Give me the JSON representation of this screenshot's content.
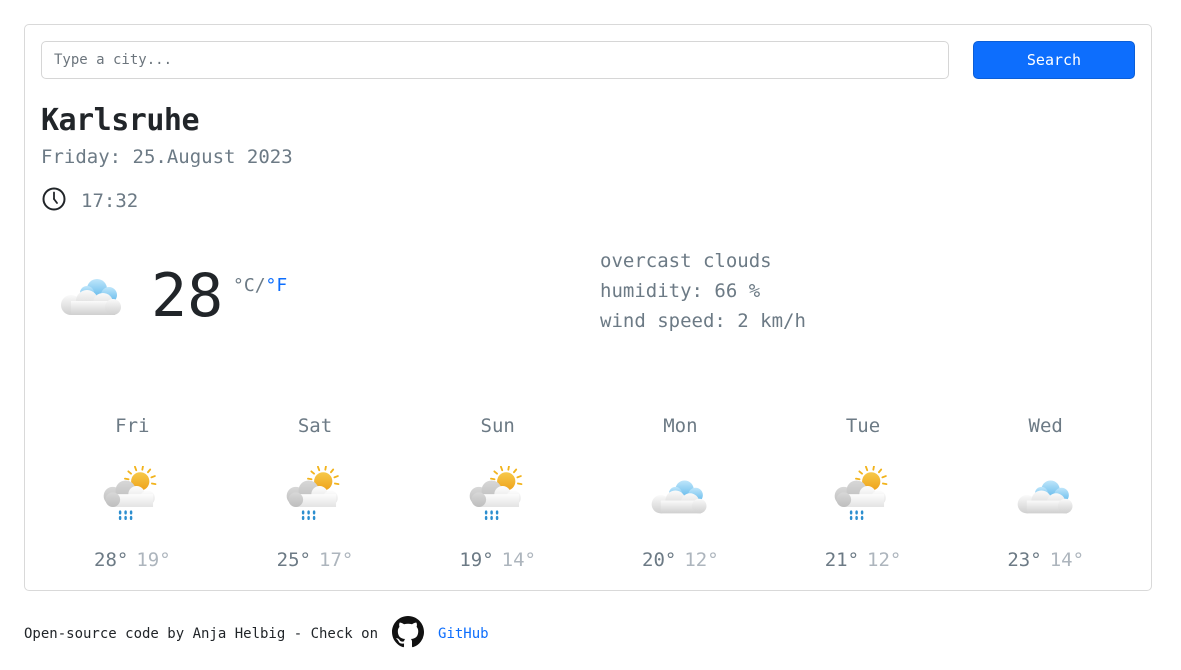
{
  "search": {
    "placeholder": "Type a city...",
    "button_label": "Search"
  },
  "current": {
    "city": "Karlsruhe",
    "date": "Friday: 25.August 2023",
    "time": "17:32",
    "temperature": "28",
    "unit_c": "°C",
    "unit_sep": "/",
    "unit_f": "°F",
    "icon": "overcast-clouds-icon",
    "description": "overcast clouds",
    "humidity": "humidity: 66 %",
    "wind": "wind speed: 2 km/h"
  },
  "forecast": [
    {
      "day": "Fri",
      "max": "28°",
      "min": "19°",
      "icon": "rain-sun-icon"
    },
    {
      "day": "Sat",
      "max": "25°",
      "min": "17°",
      "icon": "rain-sun-icon"
    },
    {
      "day": "Sun",
      "max": "19°",
      "min": "14°",
      "icon": "rain-sun-icon"
    },
    {
      "day": "Mon",
      "max": "20°",
      "min": "12°",
      "icon": "overcast-clouds-icon"
    },
    {
      "day": "Tue",
      "max": "21°",
      "min": "12°",
      "icon": "rain-sun-icon"
    },
    {
      "day": "Wed",
      "max": "23°",
      "min": "14°",
      "icon": "overcast-clouds-icon"
    }
  ],
  "footer": {
    "text": "Open-source code by Anja Helbig - Check on",
    "link_label": "GitHub"
  },
  "colors": {
    "accent": "#0d6efd",
    "muted": "#6c7a85",
    "light": "#adb5bd"
  }
}
